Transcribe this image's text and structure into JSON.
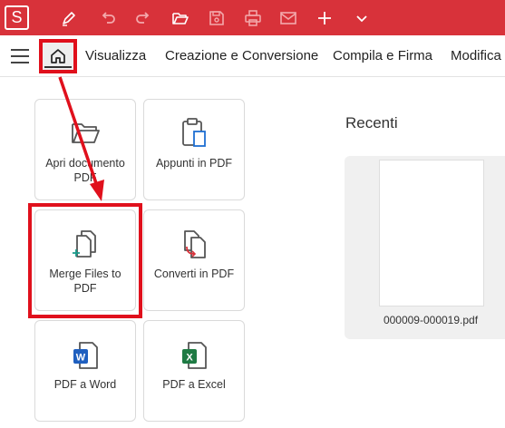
{
  "app": {
    "logo_letter": "S"
  },
  "toolbar": {
    "icons": [
      "pen-icon",
      "undo-icon",
      "redo-icon",
      "open-folder-icon",
      "save-icon",
      "print-icon",
      "mail-icon",
      "plus-icon",
      "chevron-down-icon"
    ]
  },
  "menu": {
    "items": [
      {
        "label": "Visualizza"
      },
      {
        "label": "Creazione e Conversione"
      },
      {
        "label": "Compila e Firma"
      },
      {
        "label": "Modifica"
      }
    ]
  },
  "tiles": [
    {
      "label": "Apri documento PDF",
      "icon": "folder-icon"
    },
    {
      "label": "Appunti in PDF",
      "icon": "clipboard-icon"
    },
    {
      "label": "Merge Files to PDF",
      "icon": "merge-icon"
    },
    {
      "label": "Converti in PDF",
      "icon": "convert-icon"
    },
    {
      "label": "PDF a Word",
      "icon": "word-icon"
    },
    {
      "label": "PDF a Excel",
      "icon": "excel-icon"
    }
  ],
  "recent": {
    "title": "Recenti",
    "files": [
      {
        "name": "000009-000019.pdf"
      }
    ]
  },
  "colors": {
    "titlebar": "#d8323a",
    "highlight": "#e0101c",
    "word": "#1f5fbf",
    "excel": "#1e7a43"
  }
}
